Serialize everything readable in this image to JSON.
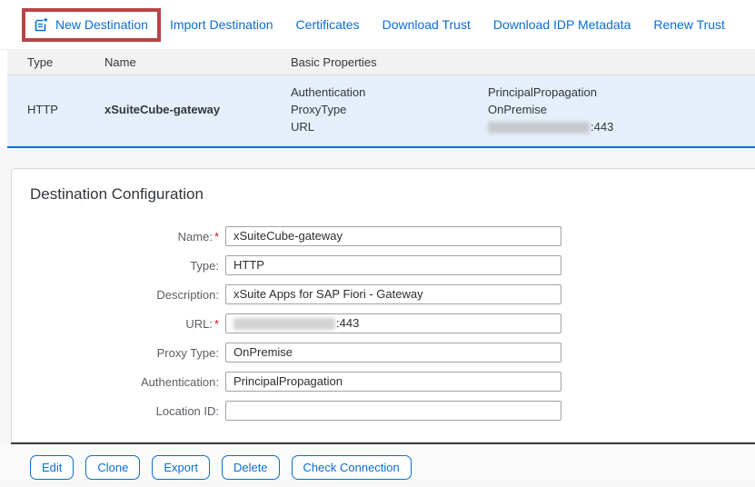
{
  "toolbar": {
    "items": [
      {
        "label": "New Destination",
        "icon": "new-destination-icon",
        "highlighted": true
      },
      {
        "label": "Import Destination"
      },
      {
        "label": "Certificates"
      },
      {
        "label": "Download Trust"
      },
      {
        "label": "Download IDP Metadata"
      },
      {
        "label": "Renew Trust"
      }
    ]
  },
  "table": {
    "columns": {
      "type": "Type",
      "name": "Name",
      "basic_properties": "Basic Properties"
    },
    "row": {
      "type": "HTTP",
      "name": "xSuiteCube-gateway",
      "property_keys": {
        "k0": "Authentication",
        "k1": "ProxyType",
        "k2": "URL"
      },
      "property_values": {
        "v0": "PrincipalPropagation",
        "v1": "OnPremise",
        "v2_suffix": ":443",
        "v2_redacted": true
      }
    }
  },
  "panel": {
    "title": "Destination Configuration",
    "fields": [
      {
        "label": "Name:",
        "required_marker": "*",
        "value": "xSuiteCube-gateway"
      },
      {
        "label": "Type:",
        "value": "HTTP"
      },
      {
        "label": "Description:",
        "value": "xSuite Apps for SAP Fiori - Gateway"
      },
      {
        "label": "URL:",
        "required_marker": "*",
        "value_suffix": ":443",
        "redacted": true
      },
      {
        "label": "Proxy Type:",
        "value": "OnPremise"
      },
      {
        "label": "Authentication:",
        "value": "PrincipalPropagation"
      },
      {
        "label": "Location ID:",
        "value": ""
      }
    ],
    "buttons": {
      "edit": "Edit",
      "clone": "Clone",
      "export": "Export",
      "delete": "Delete",
      "check_connection": "Check Connection"
    }
  },
  "colors": {
    "accent_blue": "#0a6ed1",
    "annotation_red": "#b94444",
    "selected_row_bg": "#e5eff9",
    "header_bg": "#f2f2f2"
  }
}
